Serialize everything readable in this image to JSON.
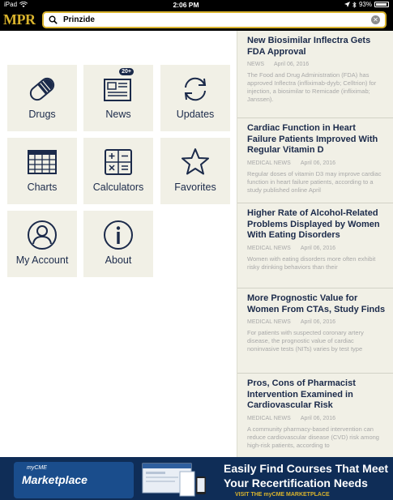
{
  "status": {
    "device": "iPad",
    "time": "2:06 PM",
    "battery": "93%"
  },
  "header": {
    "logo": "MPR",
    "search_value": "Prinzide"
  },
  "tiles": [
    {
      "label": "Drugs",
      "icon": "pill-icon"
    },
    {
      "label": "News",
      "icon": "newspaper-icon",
      "badge": "20+"
    },
    {
      "label": "Updates",
      "icon": "refresh-icon"
    },
    {
      "label": "Charts",
      "icon": "table-grid-icon"
    },
    {
      "label": "Calculators",
      "icon": "calculator-icon"
    },
    {
      "label": "Favorites",
      "icon": "star-icon"
    },
    {
      "label": "My Account",
      "icon": "user-icon"
    },
    {
      "label": "About",
      "icon": "info-icon"
    }
  ],
  "news": [
    {
      "title": "New Biosimilar Inflectra Gets FDA Approval",
      "category": "NEWS",
      "date": "April 06, 2016",
      "summary": "The Food and Drug Administration (FDA) has approved Inflectra (infliximab-dyyb; Celltrion) for injection, a biosimilar to Remicade (infliximab; Janssen)."
    },
    {
      "title": "Cardiac Function in Heart Failure Patients Improved With Regular Vitamin D",
      "category": "MEDICAL NEWS",
      "date": "April 06, 2016",
      "summary": "Regular doses of vitamin D3 may improve cardiac function in heart failure patients, according to a study published online April"
    },
    {
      "title": "Higher Rate of Alcohol-Related Problems Displayed by Women With Eating Disorders",
      "category": "MEDICAL NEWS",
      "date": "April 06, 2016",
      "summary": "Women with eating disorders more often exhibit risky drinking behaviors than their"
    },
    {
      "title": "More Prognostic Value for Women From CTAs, Study Finds",
      "category": "MEDICAL NEWS",
      "date": "April 06, 2016",
      "summary": "For patients with suspected coronary artery disease, the prognostic value of cardiac noninvasive tests (NITs) varies by test type"
    },
    {
      "title": "Pros, Cons of Pharmacist Intervention Examined in Cardiovascular Risk",
      "category": "MEDICAL NEWS",
      "date": "April 06, 2016",
      "summary": "A community pharmacy-based intervention can reduce cardiovascular disease (CVD) risk among high-risk patients, according to"
    }
  ],
  "banner": {
    "brand_small": "myCME",
    "brand_large": "Marketplace",
    "headline_1": "Easily Find Courses That Meet",
    "headline_2": "Your Recertification Needs",
    "cta": "VISIT THE myCME MARKETPLACE"
  },
  "colors": {
    "accent": "#d9b32d",
    "navy": "#1b2a4a",
    "tile_bg": "#f1f0e6"
  }
}
